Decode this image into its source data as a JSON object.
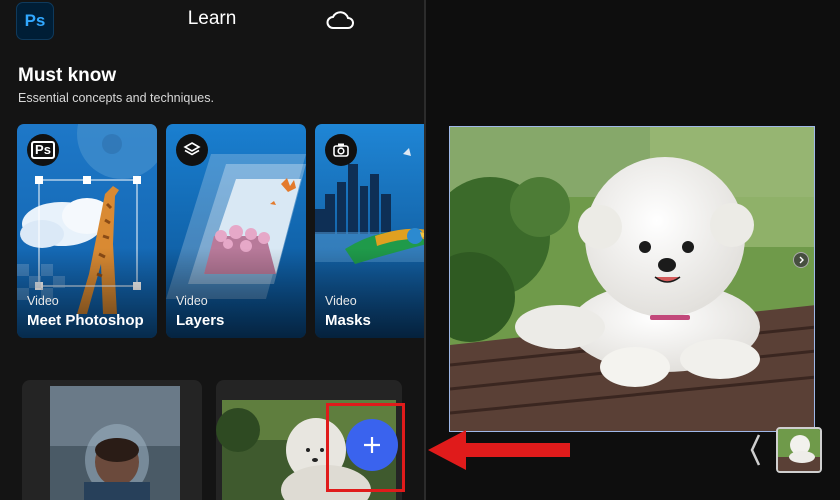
{
  "header": {
    "app_logo_text": "Ps",
    "title": "Learn",
    "cloud_icon": "cloud-icon"
  },
  "section": {
    "title": "Must know",
    "subtitle": "Essential concepts and techniques."
  },
  "cards": [
    {
      "type": "Video",
      "title": "Meet Photoshop",
      "badge_text": "Ps",
      "badge_icon": "ps-icon"
    },
    {
      "type": "Video",
      "title": "Layers",
      "badge_icon": "layers-icon"
    },
    {
      "type": "Video",
      "title": "Masks",
      "badge_icon": "camera-icon"
    }
  ],
  "recent": {
    "items": [
      "recent-photo-child",
      "recent-photo-dog"
    ]
  },
  "add_button": {
    "icon": "plus-icon"
  },
  "canvas": {
    "subject": "white-dog-on-bench-photo",
    "nav_icon": "chevron-right-icon"
  },
  "filmstrip": {
    "prev_icon": "chevron-left-icon",
    "thumb": "dog-thumbnail"
  },
  "annotation": {
    "color": "#e01b1b",
    "arrow_icon": "arrow-left-icon"
  },
  "colors": {
    "background": "#141414",
    "accent_blue": "#3a63ee",
    "ps_blue": "#31a8ff",
    "highlight_red": "#e01b1b"
  }
}
